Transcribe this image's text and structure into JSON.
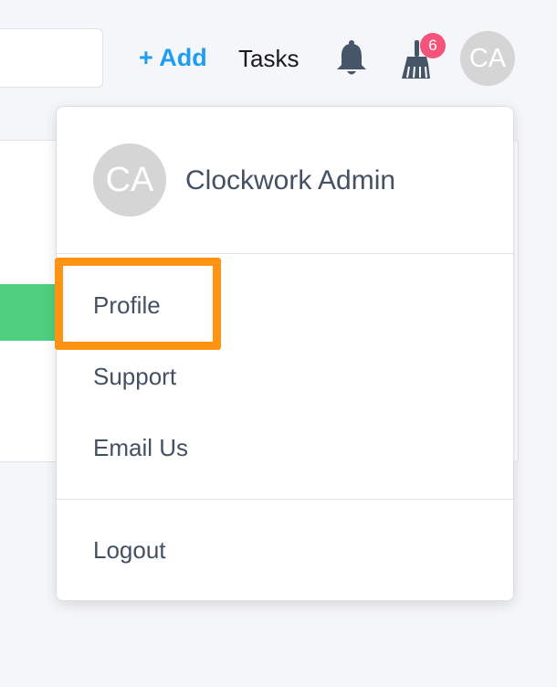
{
  "header": {
    "add_label": "+ Add",
    "tasks_label": "Tasks",
    "notification_count": "6",
    "avatar_initials": "CA"
  },
  "dropdown": {
    "user": {
      "initials": "CA",
      "name": "Clockwork Admin"
    },
    "items": [
      {
        "label": "Profile"
      },
      {
        "label": "Support"
      },
      {
        "label": "Email Us"
      }
    ],
    "logout_label": "Logout"
  },
  "colors": {
    "accent": "#1e9df3",
    "badge": "#f4547a",
    "highlight": "#ff9314",
    "success": "#4fcf7f",
    "text": "#445063",
    "icon": "#475569"
  }
}
